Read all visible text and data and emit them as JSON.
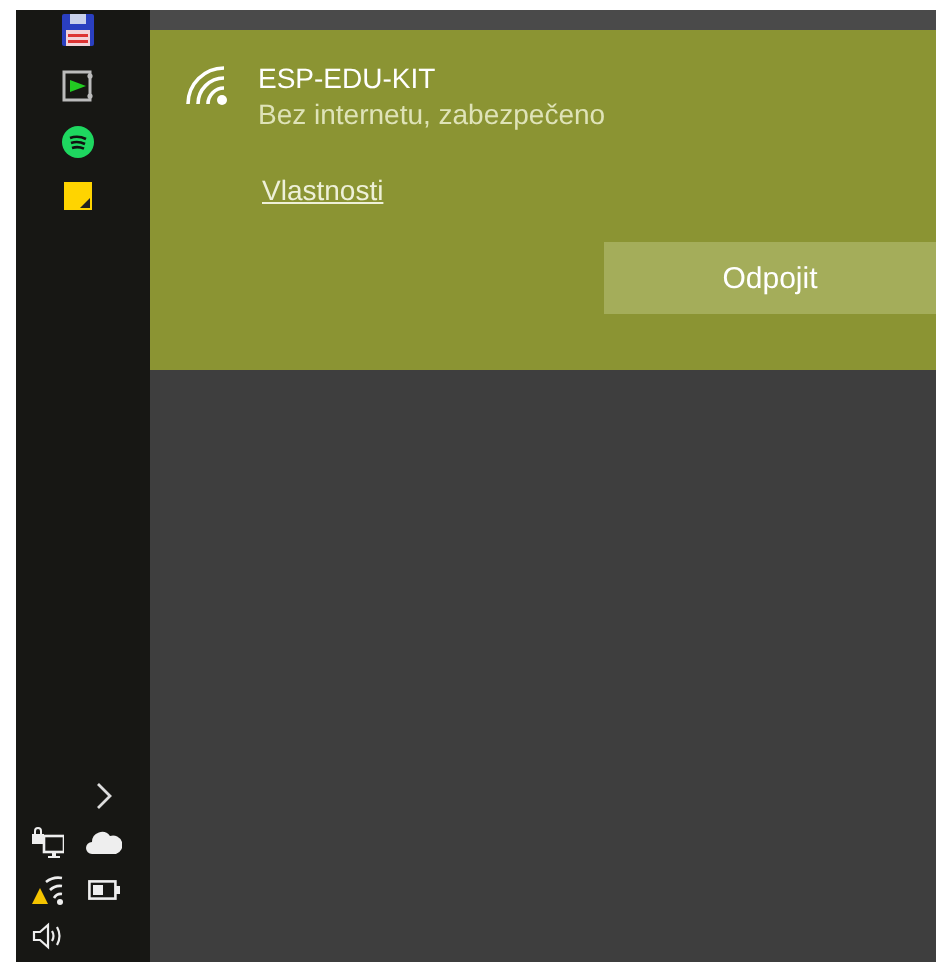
{
  "network": {
    "name": "ESP-EDU-KIT",
    "status": "Bez internetu, zabezpečeno",
    "properties_link": "Vlastnosti",
    "disconnect_button": "Odpojit"
  }
}
